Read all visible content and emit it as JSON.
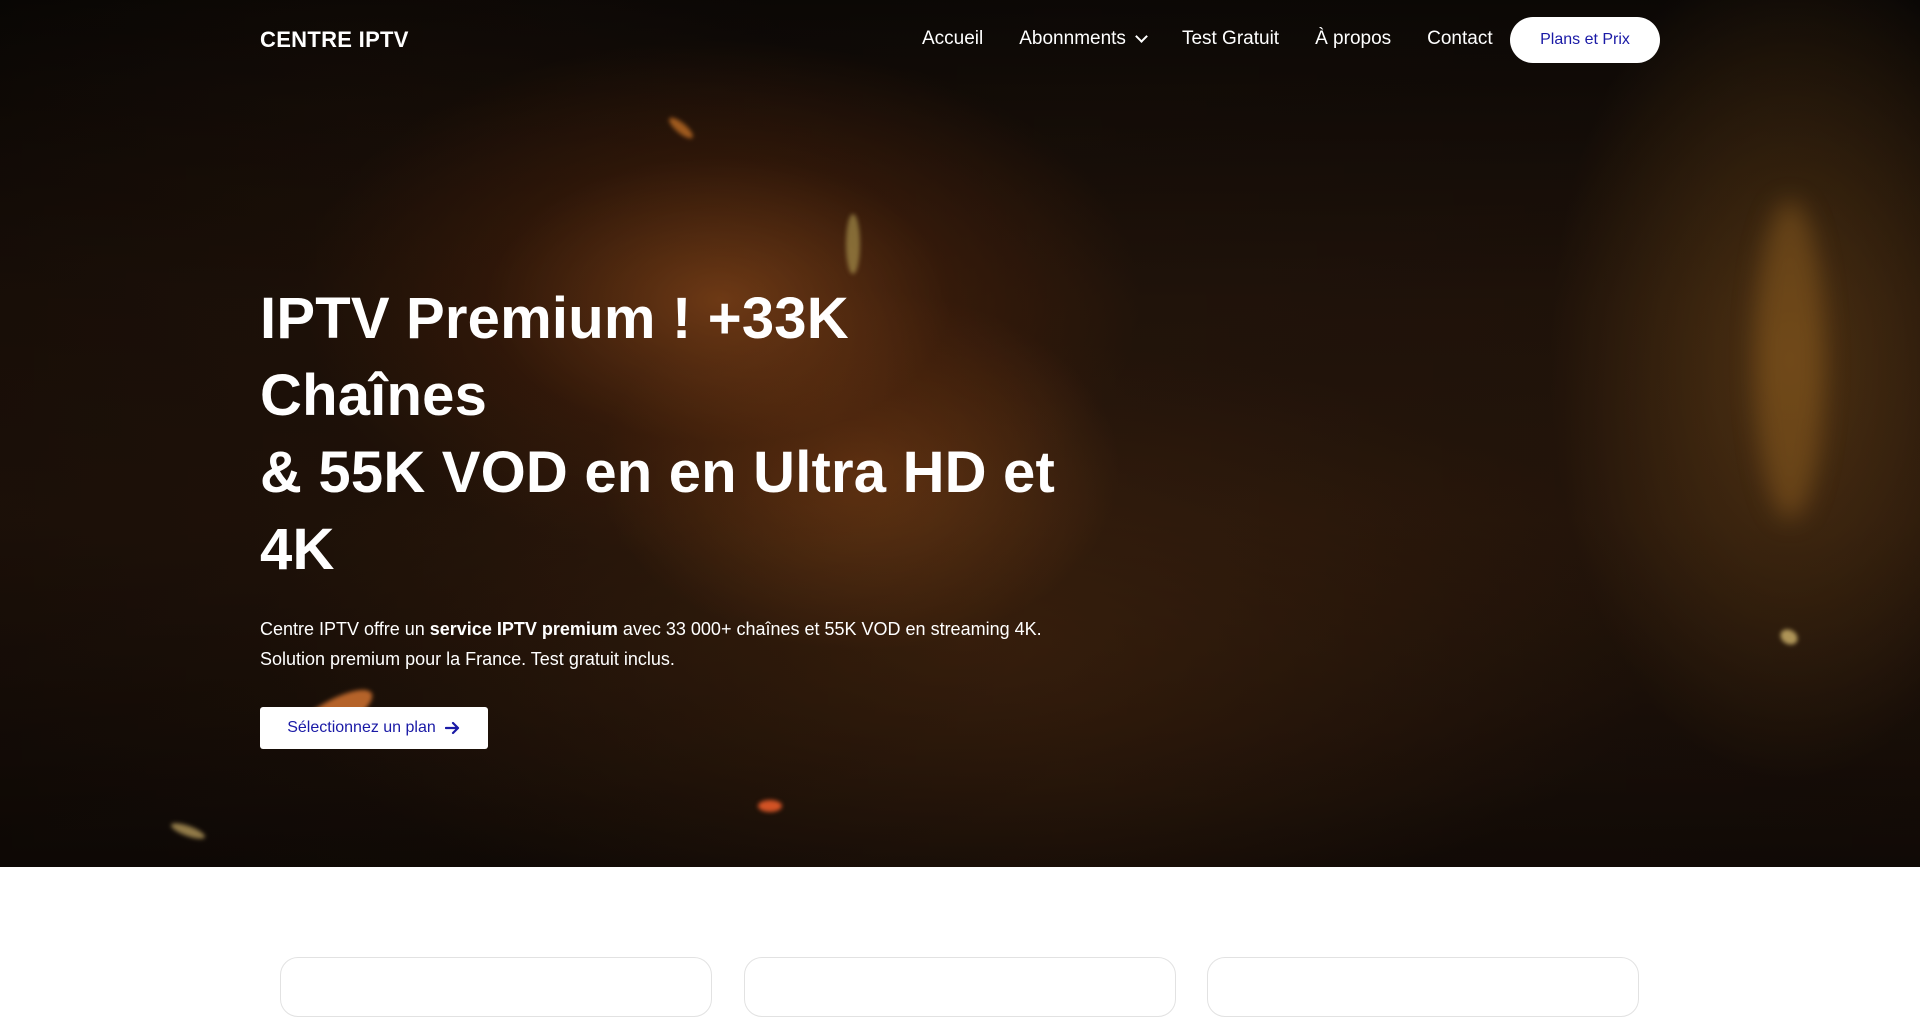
{
  "brand": "CENTRE IPTV",
  "nav": {
    "items": [
      {
        "label": "Accueil"
      },
      {
        "label": "Abonnments"
      },
      {
        "label": "Test Gratuit"
      },
      {
        "label": "À propos"
      },
      {
        "label": "Contact"
      }
    ],
    "cta": "Plans et Prix"
  },
  "hero": {
    "title_line1": "IPTV Premium ! +33K Chaînes",
    "title_line2": "& 55K VOD en en Ultra HD et 4K",
    "desc_prefix": "Centre IPTV offre un ",
    "desc_bold": "service IPTV premium",
    "desc_suffix": " avec 33 000+ chaînes et 55K VOD en streaming 4K.",
    "desc_line2": "Solution premium pour la France. Test gratuit inclus.",
    "cta": "Sélectionnez un plan"
  },
  "colors": {
    "cta_text": "#1a1aa6",
    "hero_background": "#24150b",
    "page_background": "#ffffff"
  },
  "icons": {
    "dropdown": "chevron-down-icon",
    "cta_arrow": "arrow-right-icon"
  }
}
